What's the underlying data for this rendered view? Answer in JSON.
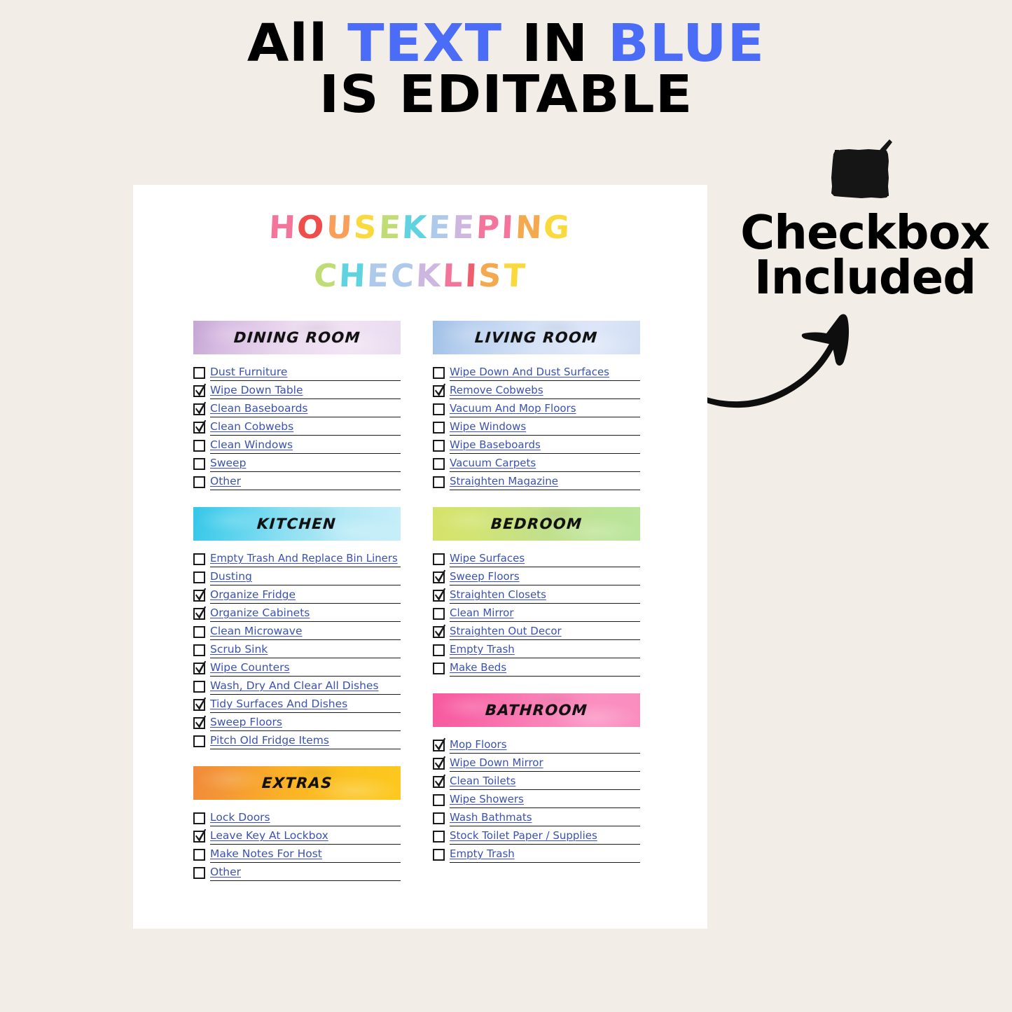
{
  "promo": {
    "line1_part1": "All ",
    "line1_blue1": "TEXT",
    "line1_part2": " IN ",
    "line1_blue2": "BLUE",
    "line2": "IS EDITABLE",
    "blue_color": "#4A6CF7"
  },
  "callout": {
    "icon": "checkbox-checked-icon",
    "line1": "Checkbox",
    "line2": "Included",
    "arrow_icon": "curved-arrow-icon"
  },
  "page": {
    "title_line1": "HOUSEKEEPING",
    "title_line2": "CHECKLIST",
    "title_line1_colors": [
      "#F4759B",
      "#EF4C4C",
      "#F8A05A",
      "#FAD93C",
      "#BFDD74",
      "#5FD4E0",
      "#AFC9EA",
      "#CDB6E0",
      "#F4759B",
      "#F4759B",
      "#F4A94E",
      "#FAD93C",
      "#FAD93C"
    ],
    "title_line2_colors": [
      "#BFDD74",
      "#5FD4E0",
      "#AFC9EA",
      "#AFC9EA",
      "#CDB6E0",
      "#F4759B",
      "#EF5E6E",
      "#F4A94E",
      "#FAD93C",
      "#BFDD74"
    ],
    "link_color": "#3B52B4"
  },
  "sections": [
    {
      "id": "dining-room",
      "title": "DINING ROOM",
      "banner_class": "bn-dining",
      "banner_color": "#ecdcf0",
      "column": "left",
      "items": [
        {
          "label": "Dust Furniture",
          "checked": false
        },
        {
          "label": "Wipe Down Table",
          "checked": true
        },
        {
          "label": "Clean Baseboards",
          "checked": true
        },
        {
          "label": "Clean Cobwebs",
          "checked": true
        },
        {
          "label": "Clean Windows",
          "checked": false
        },
        {
          "label": "Sweep",
          "checked": false
        },
        {
          "label": "Other",
          "checked": false
        }
      ]
    },
    {
      "id": "kitchen",
      "title": "KITCHEN",
      "banner_class": "bn-kitchen",
      "banner_color": "#8fe0f2",
      "column": "left",
      "items": [
        {
          "label": "Empty Trash And Replace Bin Liners",
          "checked": false
        },
        {
          "label": "Dusting",
          "checked": false
        },
        {
          "label": "Organize Fridge",
          "checked": true
        },
        {
          "label": "Organize Cabinets",
          "checked": true
        },
        {
          "label": "Clean Microwave",
          "checked": false
        },
        {
          "label": "Scrub Sink",
          "checked": false
        },
        {
          "label": "Wipe Counters",
          "checked": true
        },
        {
          "label": "Wash, Dry And Clear All Dishes",
          "checked": false
        },
        {
          "label": "Tidy Surfaces And Dishes",
          "checked": true
        },
        {
          "label": "Sweep Floors",
          "checked": true
        },
        {
          "label": "Pitch Old Fridge Items",
          "checked": false
        }
      ]
    },
    {
      "id": "extras",
      "title": "EXTRAS",
      "banner_class": "bn-extras",
      "banner_color": "#fbb326",
      "column": "left",
      "items": [
        {
          "label": "Lock Doors",
          "checked": false
        },
        {
          "label": "Leave Key At Lockbox",
          "checked": true
        },
        {
          "label": "Make Notes For Host",
          "checked": false
        },
        {
          "label": "Other",
          "checked": false
        }
      ]
    },
    {
      "id": "living-room",
      "title": "LIVING ROOM",
      "banner_class": "bn-living",
      "banner_color": "#d6e2f6",
      "column": "right",
      "items": [
        {
          "label": "Wipe Down And Dust Surfaces",
          "checked": false
        },
        {
          "label": "Remove Cobwebs",
          "checked": true
        },
        {
          "label": "Vacuum And Mop Floors",
          "checked": false
        },
        {
          "label": "Wipe Windows",
          "checked": false
        },
        {
          "label": "Wipe Baseboards",
          "checked": false
        },
        {
          "label": "Vacuum Carpets",
          "checked": false
        },
        {
          "label": "Straighten Magazine",
          "checked": false
        }
      ]
    },
    {
      "id": "bedroom",
      "title": "BEDROOM",
      "banner_class": "bn-bedroom",
      "banner_color": "#c3e08a",
      "column": "right",
      "items": [
        {
          "label": "Wipe Surfaces",
          "checked": false
        },
        {
          "label": "Sweep Floors",
          "checked": true
        },
        {
          "label": "Straighten Closets",
          "checked": true
        },
        {
          "label": "Clean Mirror",
          "checked": false
        },
        {
          "label": "Straighten Out Decor",
          "checked": true
        },
        {
          "label": "Empty Trash",
          "checked": false
        },
        {
          "label": "Make Beds",
          "checked": false
        }
      ]
    },
    {
      "id": "bathroom",
      "title": "BATHROOM",
      "banner_class": "bn-bathroom",
      "banner_color": "#fa82b8",
      "column": "right",
      "items": [
        {
          "label": "Mop Floors",
          "checked": true
        },
        {
          "label": "Wipe Down Mirror",
          "checked": true
        },
        {
          "label": "Clean Toilets",
          "checked": true
        },
        {
          "label": "Wipe Showers",
          "checked": false
        },
        {
          "label": "Wash Bathmats",
          "checked": false
        },
        {
          "label": "Stock Toilet Paper / Supplies",
          "checked": false
        },
        {
          "label": "Empty Trash",
          "checked": false
        }
      ]
    }
  ]
}
